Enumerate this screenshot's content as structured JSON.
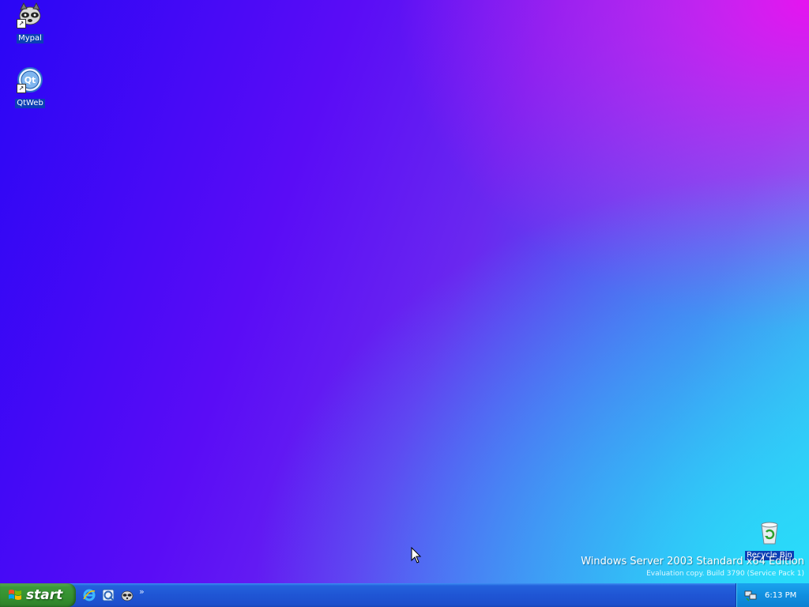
{
  "desktop": {
    "icons": [
      {
        "label": "Mypal",
        "icon": "raccoon-icon"
      },
      {
        "label": "QtWeb",
        "icon": "qt-icon"
      },
      {
        "label": "Recycle Bin",
        "icon": "recycle-bin-icon"
      }
    ],
    "shortcut_marker": "↗"
  },
  "watermark": {
    "title": "Windows Server 2003 Standard x64 Edition",
    "subtitle": "Evaluation copy. Build 3790 (Service Pack 1)"
  },
  "taskbar": {
    "start_label": "start",
    "quick_launch": [
      {
        "icon": "internet-explorer-icon"
      },
      {
        "icon": "qtweb-icon"
      },
      {
        "icon": "mypal-icon"
      }
    ],
    "chevron": "»",
    "tray": {
      "icon": "network-icon",
      "clock": "6:13 PM"
    }
  },
  "colors": {
    "taskbar_blue": "#1f55d4",
    "start_green": "#34902f",
    "tray_blue": "#118fe0",
    "label_highlight": "#0b3fb5"
  }
}
